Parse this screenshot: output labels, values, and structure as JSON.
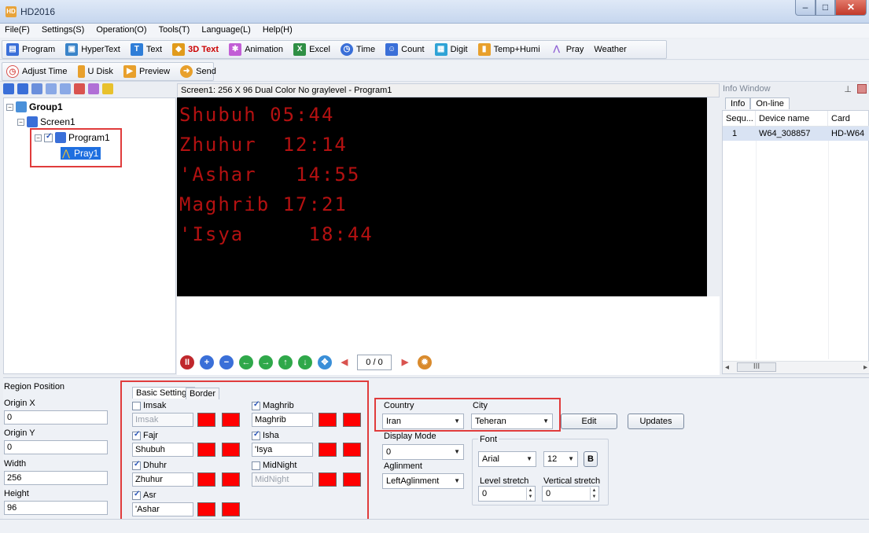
{
  "window": {
    "title": "HD2016",
    "app_icon_text": "HD"
  },
  "menu": [
    "File(F)",
    "Settings(S)",
    "Operation(O)",
    "Tools(T)",
    "Language(L)",
    "Help(H)"
  ],
  "toolbar1": [
    {
      "label": "Program",
      "icon": "program-icon",
      "color": "#3a6fd8"
    },
    {
      "label": "HyperText",
      "icon": "hypertext-icon",
      "color": "#3a84c9"
    },
    {
      "label": "Text",
      "icon": "text-icon",
      "color": "#2f7ed8"
    },
    {
      "label": "3D Text",
      "icon": "3d-text-icon",
      "color": "#e19b1c"
    },
    {
      "label": "Animation",
      "icon": "animation-icon",
      "color": "#c25fd6"
    },
    {
      "label": "Excel",
      "icon": "excel-icon",
      "color": "#2f8f45"
    },
    {
      "label": "Time",
      "icon": "time-icon",
      "color": "#3a6fd8"
    },
    {
      "label": "Count",
      "icon": "count-icon",
      "color": "#3a6fd8"
    },
    {
      "label": "Digit",
      "icon": "digit-icon",
      "color": "#2fa3d6"
    },
    {
      "label": "Temp+Humi",
      "icon": "temp-humi-icon",
      "color": "#e8a02c"
    },
    {
      "label": "Pray",
      "icon": "pray-icon",
      "color": "#8e5fd4"
    },
    {
      "label": "Weather",
      "icon": "weather-icon",
      "color": ""
    }
  ],
  "toolbar2": [
    {
      "label": "Adjust Time",
      "icon": "adjust-time-icon",
      "color": "#d9534f"
    },
    {
      "label": "U Disk",
      "icon": "u-disk-icon",
      "color": "#e8a02c"
    },
    {
      "label": "Preview",
      "icon": "preview-icon",
      "color": "#e8a02c"
    },
    {
      "label": "Send",
      "icon": "send-icon",
      "color": "#e8a02c"
    }
  ],
  "tree": {
    "group": "Group1",
    "screen": "Screen1",
    "program": "Program1",
    "pray": "Pray1"
  },
  "preview": {
    "header": "Screen1: 256 X 96  Dual Color No graylevel - Program1",
    "lines": [
      "Shubuh 05:44",
      "Zhuhur  12:14",
      "'Ashar   14:55",
      "Maghrib 17:21",
      "'Isya     18:44"
    ],
    "led_color": "#b41111",
    "page": "0 / 0"
  },
  "info": {
    "title": "Info Window",
    "tabs": [
      "Info",
      "On-line"
    ],
    "columns": [
      "Sequ...",
      "Device name",
      "Card"
    ],
    "rows": [
      [
        "1",
        "W64_308857",
        "HD-W64"
      ]
    ],
    "scroll_label": "III"
  },
  "region": {
    "title": "Region Position",
    "origin_x_label": "Origin X",
    "origin_x": "0",
    "origin_y_label": "Origin Y",
    "origin_y": "0",
    "width_label": "Width",
    "width": "256",
    "height_label": "Height",
    "height": "96"
  },
  "settings": {
    "tab_basic": "Basic Settings",
    "tab_border": "Border",
    "imsak": {
      "label": "Imsak",
      "checked": false,
      "value": "Imsak"
    },
    "fajr": {
      "label": "Fajr",
      "checked": true,
      "value": "Shubuh"
    },
    "dhuhr": {
      "label": "Dhuhr",
      "checked": true,
      "value": "Zhuhur"
    },
    "asr": {
      "label": "Asr",
      "checked": true,
      "value": "'Ashar"
    },
    "maghrib": {
      "label": "Maghrib",
      "checked": true,
      "value": "Maghrib"
    },
    "isha": {
      "label": "Isha",
      "checked": true,
      "value": "'Isya"
    },
    "midnight": {
      "label": "MidNight",
      "checked": false,
      "value": "MidNight"
    },
    "swatch_color": "#ff0000"
  },
  "location": {
    "country_label": "Country",
    "country": "Iran",
    "city_label": "City",
    "city": "Teheran",
    "edit": "Edit",
    "updates": "Updates",
    "display_mode_label": "Display Mode",
    "display_mode": "0",
    "alignment_label": "Aglinment",
    "alignment": "LeftAglinment"
  },
  "font": {
    "title": "Font",
    "family": "Arial",
    "size": "12",
    "bold": "B",
    "level_stretch_label": "Level stretch",
    "level_stretch": "0",
    "vertical_stretch_label": "Vertical stretch",
    "vertical_stretch": "0"
  },
  "highlight_color": "#e03c3c"
}
